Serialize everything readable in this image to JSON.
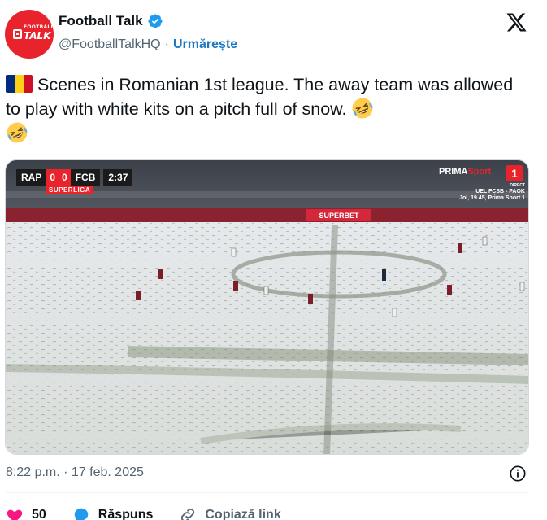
{
  "author": {
    "display_name": "Football Talk",
    "handle": "@FootballTalkHQ",
    "follow_label": "Urmărește",
    "avatar_small_text": "FOOTBALL",
    "avatar_big_text": "TALK"
  },
  "tweet": {
    "text": "Scenes in Romanian 1st league. The away team was allowed to play with white kits on a pitch full of snow.",
    "flag": "romania-flag",
    "emoji": "rolling-on-floor-laughing",
    "timestamp": "8:22 p.m. · 17 feb. 2025"
  },
  "media": {
    "home_team": "RAP",
    "home_score": "0",
    "away_score": "0",
    "away_team": "FCB",
    "clock": "2:37",
    "league": "SUPERLIGA",
    "broadcaster_prefix": "PRIMA",
    "broadcaster_suffix": "Sport",
    "channel_number": "1",
    "promo_direct": "DIRECT",
    "promo_line1": "UEL FCSB - PAOK",
    "promo_line2": "Joi, 19.45, Prima Sport 1",
    "ad_board": "SUPERBET"
  },
  "actions": {
    "likes": "50",
    "reply_label": "Răspuns",
    "copy_link_label": "Copiază link"
  },
  "colors": {
    "accent": "#1d9bf0",
    "follow": "#1d77c2",
    "like": "#f91880",
    "brand_red": "#e8232c"
  }
}
